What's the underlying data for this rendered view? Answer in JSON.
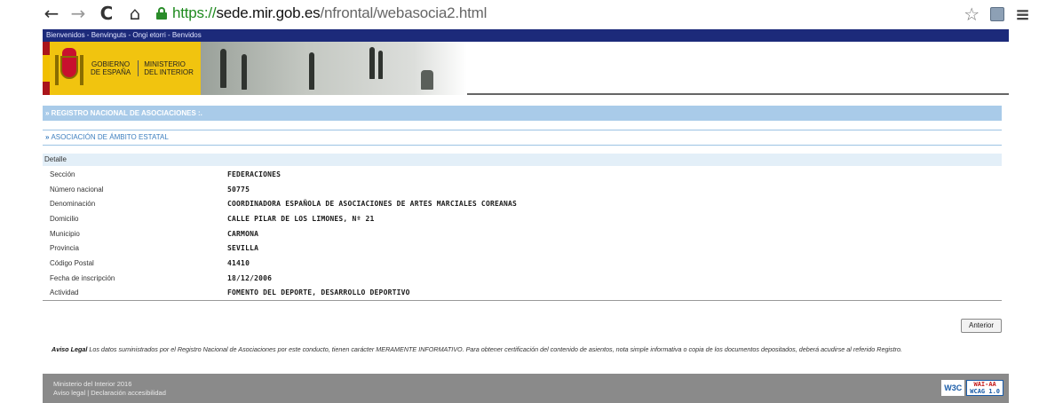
{
  "browser": {
    "url_scheme": "https://",
    "url_host": "sede.mir.gob.es",
    "url_path": "/nfrontal/webasocia2.html",
    "icons": [
      "back-icon",
      "forward-icon",
      "reload-icon",
      "home-icon",
      "lock-icon",
      "star-icon",
      "extension-icon",
      "menu-icon"
    ]
  },
  "header": {
    "top_nav": "Bienvenidos - Benvinguts - Ongi etorri - Benvidos",
    "gov_line1": "GOBIERNO",
    "gov_line2": "DE ESPAÑA",
    "ministry_line1": "MINISTERIO",
    "ministry_line2": "DEL INTERIOR"
  },
  "sections": {
    "registro": "» REGISTRO NACIONAL DE ASOCIACIONES :.",
    "asociacion": "ASOCIACIÓN DE ÁMBITO ESTATAL",
    "detalle": "Detalle"
  },
  "details": [
    {
      "label": "Sección",
      "value": "FEDERACIONES"
    },
    {
      "label": "Número nacional",
      "value": "50775"
    },
    {
      "label": "Denominación",
      "value": "COORDINADORA ESPAÑOLA DE ASOCIACIONES DE ARTES MARCIALES COREANAS"
    },
    {
      "label": "Domicilio",
      "value": "CALLE PILAR DE LOS LIMONES, Nº 21"
    },
    {
      "label": "Municipio",
      "value": "CARMONA"
    },
    {
      "label": "Provincia",
      "value": "SEVILLA"
    },
    {
      "label": "Código Postal",
      "value": "41410"
    },
    {
      "label": "Fecha de inscripción",
      "value": "18/12/2006"
    },
    {
      "label": "Actividad",
      "value": "FOMENTO DEL DEPORTE, DESARROLLO DEPORTIVO"
    }
  ],
  "actions": {
    "anterior": "Anterior"
  },
  "legal": {
    "title": "Aviso Legal",
    "text": "Los datos suministrados por el Registro Nacional de Asociaciones por este conducto, tienen carácter MERAMENTE INFORMATIVO. Para obtener certificación del contenido de asientos, nota simple informativa o copia de los documentos depositados, deberá acudirse al referido Registro."
  },
  "footer": {
    "line1": "Ministerio del Interior 2016",
    "line2": "Aviso legal | Declaración accesibilidad",
    "w3c": "W3C",
    "wai_line1": "WAI-AA",
    "wai_line2": "WCAG 1.0"
  },
  "colors": {
    "nav_blue": "#1c2a7a",
    "section_blue": "#a9cbe9",
    "link_blue": "#3e7fbf",
    "gov_yellow": "#f1c40f",
    "footer_gray": "#8a8a8a"
  }
}
